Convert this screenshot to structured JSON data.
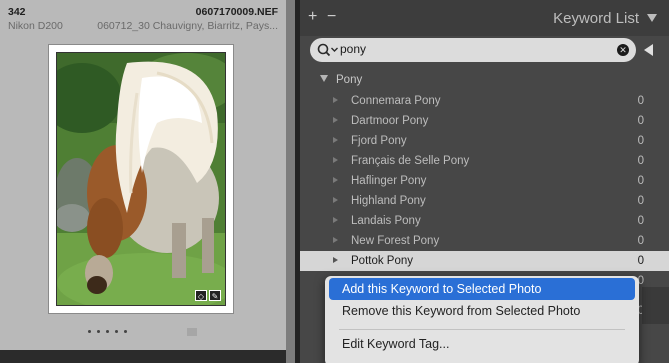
{
  "grid_cell": {
    "index": "342",
    "filename": "0607170009.NEF",
    "camera": "Nikon D200",
    "folder": "060712_30 Chauvigny, Biarritz, Pays..."
  },
  "panel": {
    "plus_label": "+",
    "minus_label": "−",
    "title": "Keyword List"
  },
  "search": {
    "value": "pony"
  },
  "tree": {
    "parent_label": "Pony",
    "keywords": [
      {
        "label": "Connemara Pony",
        "count": "0"
      },
      {
        "label": "Dartmoor Pony",
        "count": "0"
      },
      {
        "label": "Fjord Pony",
        "count": "0"
      },
      {
        "label": "Français de Selle Pony",
        "count": "0"
      },
      {
        "label": "Haflinger Pony",
        "count": "0"
      },
      {
        "label": "Highland Pony",
        "count": "0"
      },
      {
        "label": "Landais Pony",
        "count": "0"
      },
      {
        "label": "New Forest Pony",
        "count": "0"
      },
      {
        "label": "Pottok Pony",
        "count": "0"
      }
    ],
    "partial_counts": [
      "0",
      "0"
    ]
  },
  "context_menu": {
    "items": [
      {
        "label": "Add this Keyword to Selected Photo"
      },
      {
        "label": "Remove this Keyword from Selected Photo"
      },
      {
        "label": "Edit Keyword Tag..."
      }
    ]
  }
}
